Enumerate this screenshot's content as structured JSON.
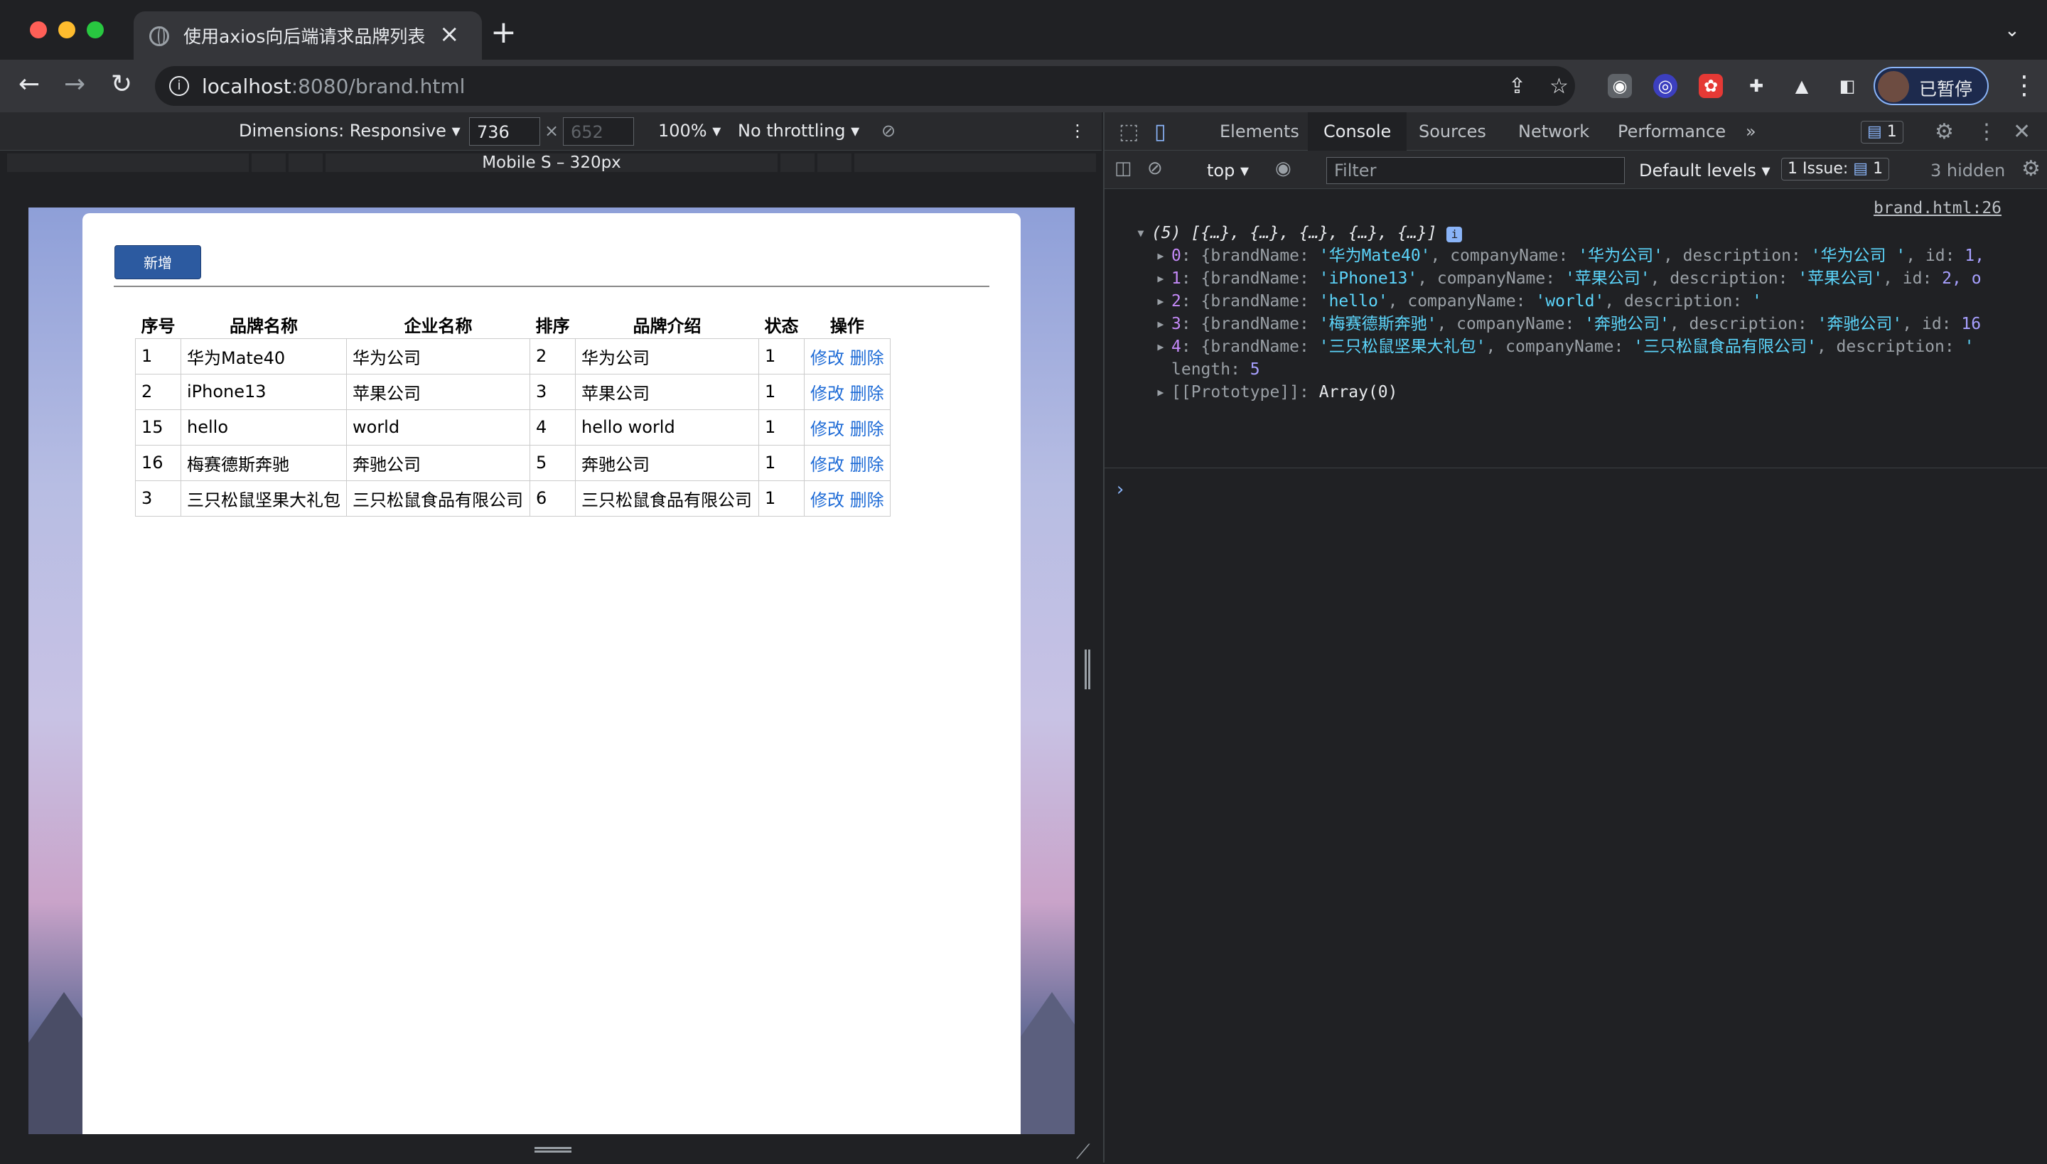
{
  "browser": {
    "tab_title": "使用axios向后端请求品牌列表数据",
    "new_tab_symbol": "+",
    "url_host": "localhost",
    "url_rest": ":8080/brand.html",
    "profile_label": "已暂停"
  },
  "emulation": {
    "dimensions_label": "Dimensions: Responsive",
    "width_value": "736",
    "height_placeholder": "652",
    "times": "×",
    "zoom": "100%",
    "throttling": "No throttling",
    "device_label": "Mobile S – 320px"
  },
  "page": {
    "add_button": "新增",
    "table": {
      "headers": [
        "序号",
        "品牌名称",
        "企业名称",
        "排序",
        "品牌介绍",
        "状态",
        "操作"
      ],
      "rows": [
        {
          "id": "1",
          "brand": "华为Mate40",
          "company": "华为公司",
          "order": "2",
          "desc": "华为公司",
          "status": "1"
        },
        {
          "id": "2",
          "brand": "iPhone13",
          "company": "苹果公司",
          "order": "3",
          "desc": "苹果公司",
          "status": "1"
        },
        {
          "id": "15",
          "brand": "hello",
          "company": "world",
          "order": "4",
          "desc": "hello world",
          "status": "1"
        },
        {
          "id": "16",
          "brand": "梅赛德斯奔驰",
          "company": "奔驰公司",
          "order": "5",
          "desc": "奔驰公司",
          "status": "1"
        },
        {
          "id": "3",
          "brand": "三只松鼠坚果大礼包",
          "company": "三只松鼠食品有限公司",
          "order": "6",
          "desc": "三只松鼠食品有限公司",
          "status": "1"
        }
      ],
      "edit_label": "修改",
      "delete_label": "删除"
    }
  },
  "devtools": {
    "tabs": [
      "Elements",
      "Console",
      "Sources",
      "Network",
      "Performance"
    ],
    "active_tab": "Console",
    "more_tabs": "»",
    "messages_badge": "1",
    "context": "top",
    "filter_placeholder": "Filter",
    "levels": "Default levels",
    "issues_label": "1 Issue:",
    "issues_count": "1",
    "hidden": "3 hidden",
    "source_link": "brand.html:26",
    "array_summary": "(5) [{…}, {…}, {…}, {…}, {…}]",
    "entries": [
      {
        "index": "0",
        "brand": "'华为Mate40'",
        "company": "'华为公司'",
        "desc": "'华为公司 '",
        "tail": ", id: ",
        "tail_num": "1,"
      },
      {
        "index": "1",
        "brand": "'iPhone13'",
        "company": "'苹果公司'",
        "desc": "'苹果公司'",
        "tail": ", id: ",
        "tail_num": "2, o"
      },
      {
        "index": "2",
        "brand": "'hello'",
        "company": "'world'",
        "desc": "'",
        "tail": "",
        "tail_num": ""
      },
      {
        "index": "3",
        "brand": "'梅赛德斯奔驰'",
        "company": "'奔驰公司'",
        "desc": "'奔驰公司'",
        "tail": ", id: ",
        "tail_num": "16"
      },
      {
        "index": "4",
        "brand": "'三只松鼠坚果大礼包'",
        "company": "'三只松鼠食品有限公司'",
        "desc": "'",
        "tail": "",
        "tail_num": ""
      }
    ],
    "length_key": "length",
    "length_value": "5",
    "prototype_key": "[[Prototype]]",
    "prototype_value": "Array(0)",
    "prompt_symbol": "›"
  },
  "colors": {
    "add_button": "#2c5aa0",
    "link": "#1e6bd6",
    "console_string": "#5cd5fb",
    "console_number": "#a7a0ff"
  },
  "icons": [
    "globe-icon",
    "close-icon",
    "back-icon",
    "forward-icon",
    "reload-icon",
    "info-icon",
    "share-icon",
    "star-icon",
    "camera-icon",
    "extension-icon",
    "puzzle-icon",
    "flask-icon",
    "sidepanel-icon",
    "kebab-icon",
    "inspect-icon",
    "device-toolbar-icon",
    "gear-icon",
    "clear-console-icon",
    "eye-icon",
    "rotate-icon"
  ]
}
